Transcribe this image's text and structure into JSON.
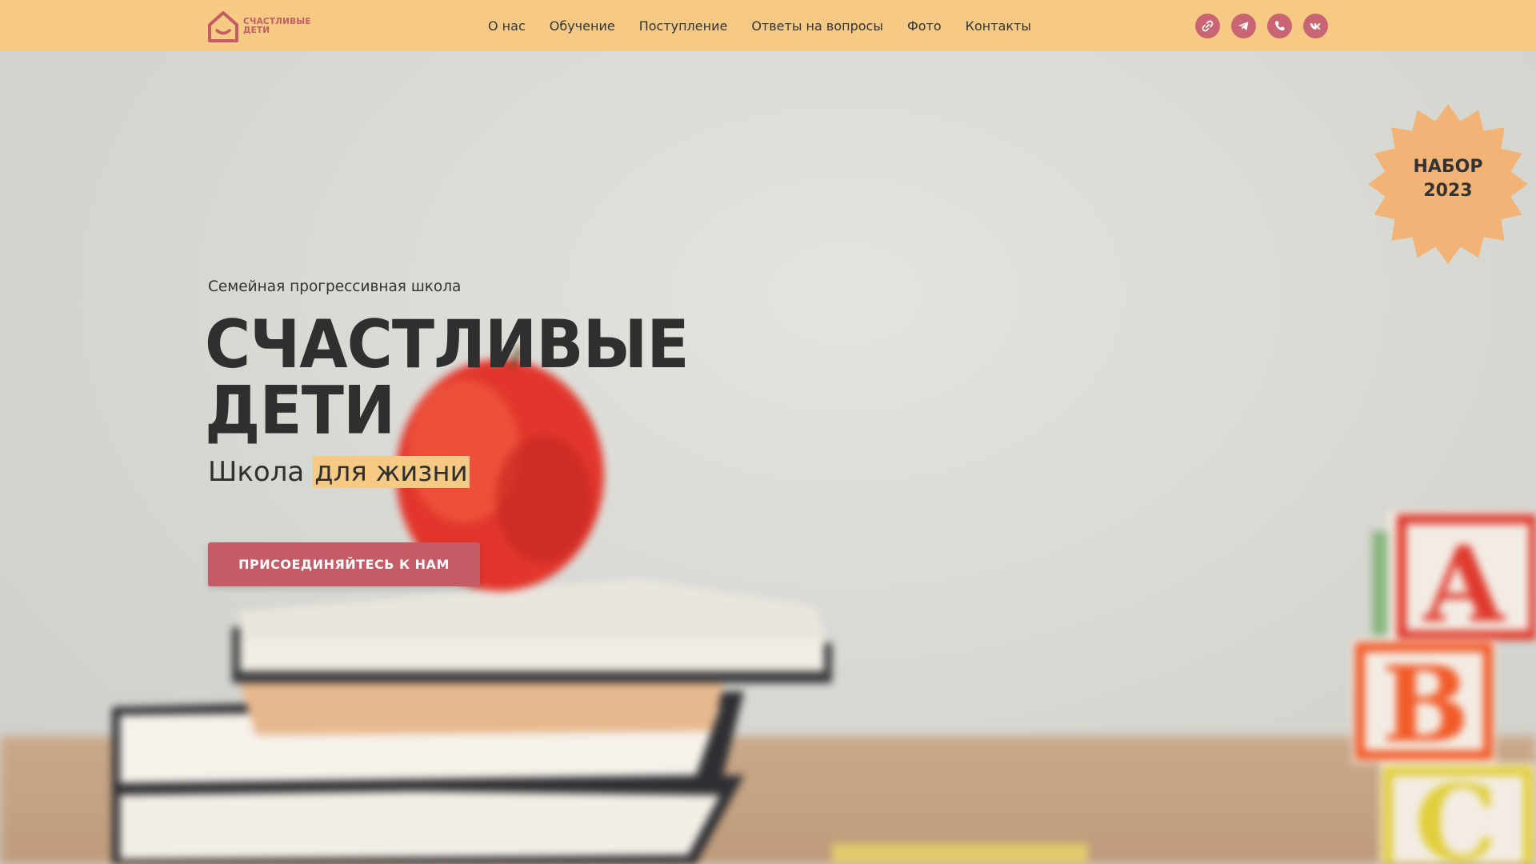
{
  "header": {
    "logo_line1": "СЧАСТЛИВЫЕ",
    "logo_line2": "ДЕТИ",
    "nav": [
      "О нас",
      "Обучение",
      "Поступление",
      "Ответы на вопросы",
      "Фото",
      "Контакты"
    ],
    "socials": [
      "link-icon",
      "telegram-icon",
      "whatsapp-icon",
      "vk-icon"
    ]
  },
  "hero": {
    "subtitle": "Семейная прогрессивная школа",
    "title_line1": "СЧАСТЛИВЫЕ",
    "title_line2": "ДЕТИ",
    "tagline_prefix": "Школа",
    "tagline_highlight": "для жизни",
    "cta_label": "ПРИСОЕДИНЯЙТЕСЬ К НАМ",
    "badge_line1": "НАБОР",
    "badge_line2": "2023"
  },
  "colors": {
    "header_bg": "#f6ca85",
    "accent": "#c35c67",
    "highlight": "#f6ca85",
    "badge": "#f1b476",
    "text": "#2f2f2f"
  }
}
